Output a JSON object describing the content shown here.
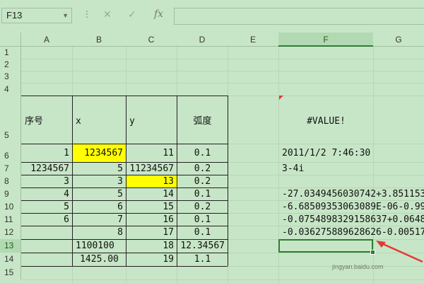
{
  "name_box": "F13",
  "columns": [
    "A",
    "B",
    "C",
    "D",
    "E",
    "F",
    "G"
  ],
  "rows": [
    "1",
    "2",
    "3",
    "4",
    "5",
    "6",
    "7",
    "8",
    "9",
    "10",
    "11",
    "12",
    "13",
    "14",
    "15"
  ],
  "headers": {
    "a": "序号",
    "b": "x",
    "c": "y",
    "d": "弧度"
  },
  "f5": "#VALUE!",
  "cells": {
    "a6": "1",
    "b6": "1234567",
    "c6": "11",
    "d6": "0.1",
    "f6": "2011/1/2 7:46:30",
    "a7": "1234567",
    "b7": "5",
    "c7": "11234567",
    "d7": "0.2",
    "f7": "3-4i",
    "a8": "3",
    "b8": "3",
    "c8": "13",
    "d8": "0.2",
    "a9": "4",
    "b9": "5",
    "c9": "14",
    "d9": "0.1",
    "f9": "-27.0349456030742+3.851153",
    "a10": "5",
    "b10": "6",
    "c10": "15",
    "d10": "0.2",
    "f10": "-6.68509353063089E-06-0.99",
    "a11": "6",
    "b11": "7",
    "c11": "16",
    "d11": "0.1",
    "f11": "-0.0754898329158637+0.0648",
    "b12": "8",
    "c12": "17",
    "d12": "0.1",
    "f12": "-0.036275889628626-0.00517",
    "b13": "1100100",
    "c13": "18",
    "d13": "12.34567",
    "b14": "1425.00",
    "c14": "19",
    "d14": "1.1"
  },
  "watermark": "jingyan.baidu.com",
  "colors": {
    "background": "#c7e6c7",
    "highlight": "#ffff00",
    "selection": "#2e7d32",
    "arrow": "#e53935"
  }
}
